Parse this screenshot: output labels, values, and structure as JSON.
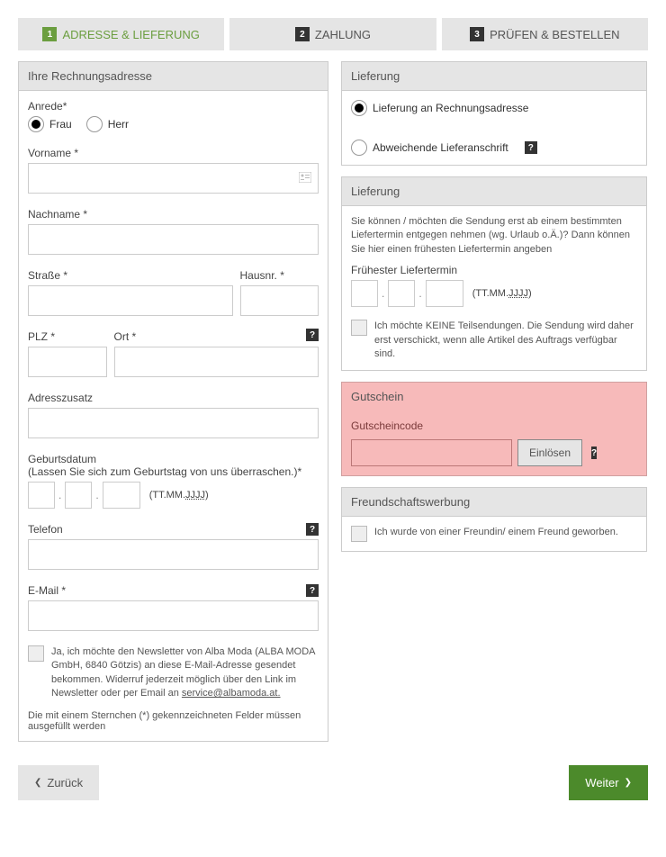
{
  "steps": [
    {
      "num": "1",
      "label": "ADRESSE & LIEFERUNG"
    },
    {
      "num": "2",
      "label": "ZAHLUNG"
    },
    {
      "num": "3",
      "label": "PRÜFEN & BESTELLEN"
    }
  ],
  "billing": {
    "header": "Ihre Rechnungsadresse",
    "salutation_label": "Anrede*",
    "salutation_frau": "Frau",
    "salutation_herr": "Herr",
    "firstname_label": "Vorname *",
    "lastname_label": "Nachname *",
    "street_label": "Straße *",
    "houseno_label": "Hausnr. *",
    "zip_label": "PLZ *",
    "city_label": "Ort *",
    "addition_label": "Adresszusatz",
    "birthdate_label": "Geburtsdatum",
    "birthdate_sub": "(Lassen Sie sich zum Geburtstag von uns überraschen.)*",
    "date_hint_prefix": "(TT.MM.",
    "date_hint_jjjj": "JJJJ",
    "date_hint_suffix": ")",
    "phone_label": "Telefon",
    "email_label": "E-Mail *",
    "newsletter_text_pre": "Ja, ich möchte den Newsletter von Alba Moda (ALBA MODA GmbH, 6840 Götzis) an diese E-Mail-Adresse gesendet bekommen. Widerruf jederzeit möglich über den Link im Newsletter oder per Email an ",
    "newsletter_link": "service@albamoda.at.",
    "required_note": "Die mit einem Sternchen (*) gekennzeichneten Felder müssen ausgefüllt werden"
  },
  "delivery": {
    "header": "Lieferung",
    "opt_billing": "Lieferung an Rechnungsadresse",
    "opt_other": "Abweichende Lieferanschrift"
  },
  "delivery2": {
    "header": "Lieferung",
    "desc": "Sie können / möchten die Sendung erst ab einem bestimmten Liefertermin entgegen nehmen (wg. Urlaub o.Ä.)? Dann können Sie hier einen frühesten Liefertermin angeben",
    "earliest_label": "Frühester Liefertermin",
    "no_partial": "Ich möchte KEINE Teilsendungen. Die Sendung wird daher erst verschickt, wenn alle Artikel des Auftrags verfügbar sind."
  },
  "voucher": {
    "header": "Gutschein",
    "code_label": "Gutscheincode",
    "redeem": "Einlösen"
  },
  "referral": {
    "header": "Freundschaftswerbung",
    "text": "Ich wurde von einer Freundin/ einem Freund geworben."
  },
  "nav": {
    "back": "Zurück",
    "next": "Weiter"
  },
  "help": "?"
}
